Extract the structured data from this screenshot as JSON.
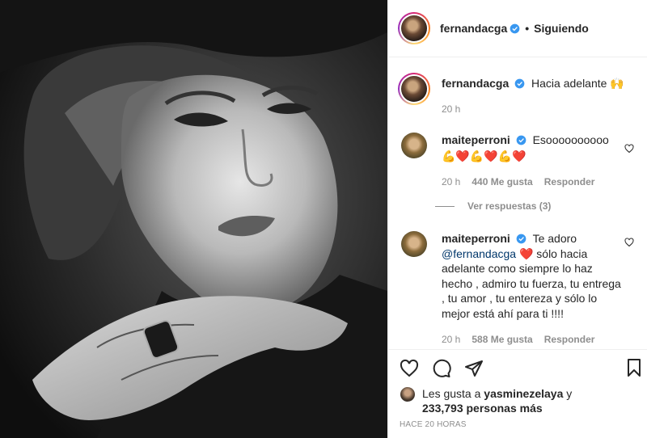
{
  "header": {
    "username": "fernandacga",
    "separator": "•",
    "follow_status": "Siguiendo"
  },
  "caption": {
    "username": "fernandacga",
    "text": "Hacia adelante",
    "emoji": "🙌",
    "time": "20 h"
  },
  "comments": [
    {
      "username": "maiteperroni",
      "text": "Esoooooooooo",
      "emoji_line": "💪❤️💪❤️💪❤️",
      "time": "20 h",
      "likes": "440 Me gusta",
      "reply_label": "Responder",
      "view_replies": "Ver respuestas (3)"
    },
    {
      "username": "maiteperroni",
      "text_before": "Te adoro",
      "mention": "@fernandacga",
      "heart": "❤️",
      "text_after": "sólo hacia adelante como siempre lo haz hecho , admiro tu fuerza, tu entrega , tu amor , tu entereza y sólo lo mejor está ahí para ti !!!!",
      "time": "20 h",
      "likes": "588 Me gusta",
      "reply_label": "Responder"
    }
  ],
  "likes_summary": {
    "prefix": "Les gusta a",
    "user": "yasminezelaya",
    "connector": "y",
    "count": "233,793",
    "suffix": "personas más"
  },
  "posted_ago": "HACE 20 HORAS",
  "icons": {
    "like": "heart-outline-icon",
    "comment": "comment-bubble-icon",
    "share": "paper-plane-icon",
    "save": "bookmark-icon",
    "verified": "verified-badge-icon"
  },
  "colors": {
    "verified": "#3897f0",
    "link": "#00376b",
    "muted": "#8e8e8e",
    "heart": "#ed4956"
  }
}
